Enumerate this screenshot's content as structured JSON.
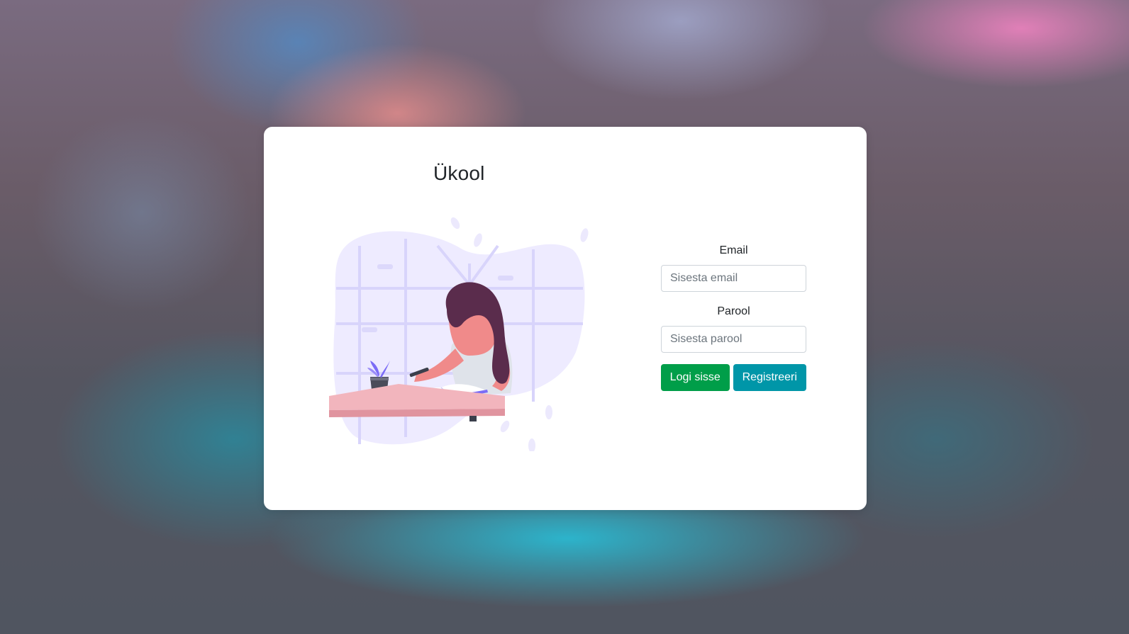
{
  "app": {
    "title": "Ükool"
  },
  "login_form": {
    "email": {
      "label": "Email",
      "placeholder": "Sisesta email",
      "value": ""
    },
    "password": {
      "label": "Parool",
      "placeholder": "Sisesta parool",
      "value": ""
    },
    "login_button": "Logi sisse",
    "register_button": "Registreeri"
  },
  "illustration": {
    "subject": "woman-writing-at-desk-illustration"
  },
  "colors": {
    "login_button": "#009e49",
    "register_button": "#0096a8",
    "illustration_accent": "#7b6cf6",
    "illustration_bg": "#eeebff",
    "desk": "#e8a0aa",
    "hair": "#5a2c4c",
    "skin": "#f08a8a"
  }
}
